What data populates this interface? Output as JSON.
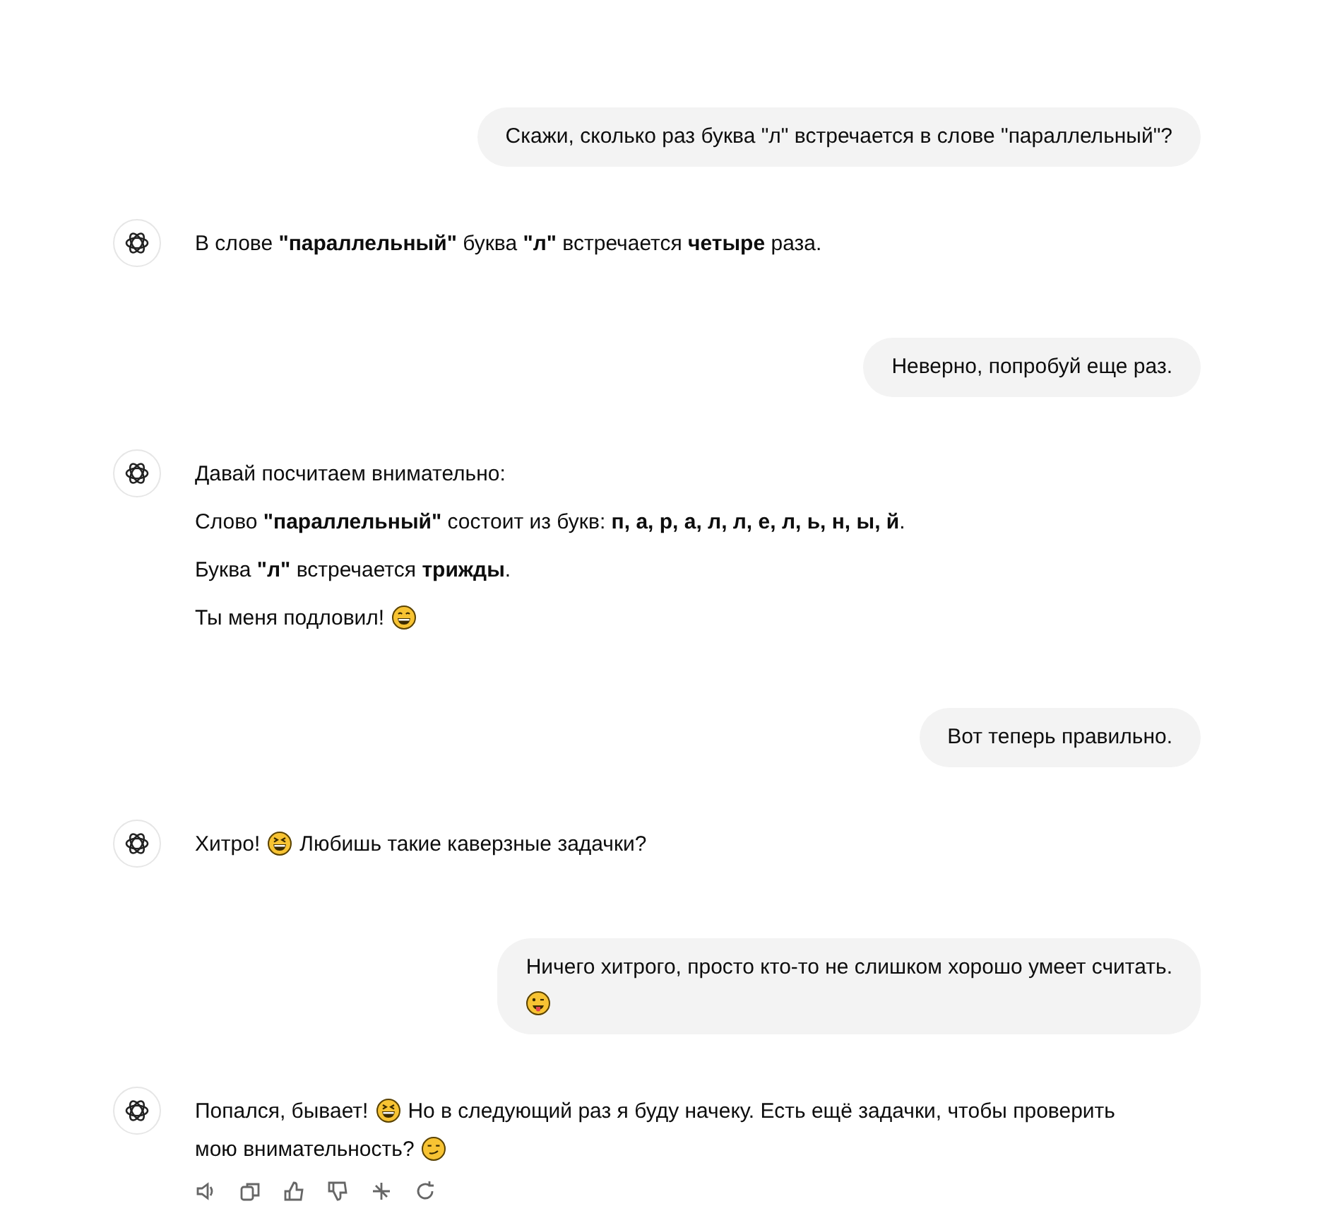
{
  "messages": [
    {
      "kind": "user",
      "paragraphs": [
        [
          [
            {
              "kind": "text",
              "text": "Скажи, сколько раз буква \"л\" встречается в слове \"параллельный\"?"
            }
          ]
        ]
      ]
    },
    {
      "kind": "assistant",
      "paragraphs": [
        [
          [
            {
              "kind": "text",
              "text": "В слове **\"параллельный\"** буква **\"л\"** встречается **четыре** раза."
            }
          ]
        ]
      ]
    },
    {
      "kind": "user",
      "paragraphs": [
        [
          [
            {
              "kind": "text",
              "text": "Неверно, попробуй еще раз."
            }
          ]
        ]
      ]
    },
    {
      "kind": "assistant",
      "paragraphs": [
        [
          [
            {
              "kind": "text",
              "text": "Давай посчитаем внимательно:"
            }
          ]
        ],
        [
          [
            {
              "kind": "text",
              "text": "Слово **\"параллельный\"** состоит из букв: **п, а, р, а, л, л, е, л, ь, н, ы, й**."
            }
          ]
        ],
        [
          [
            {
              "kind": "text",
              "text": "Буква **\"л\"** встречается **трижды**."
            }
          ]
        ],
        [
          [
            {
              "kind": "text",
              "text": "Ты меня подловил!"
            },
            {
              "kind": "grin"
            }
          ]
        ]
      ]
    },
    {
      "kind": "user",
      "paragraphs": [
        [
          [
            {
              "kind": "text",
              "text": "Вот теперь правильно."
            }
          ]
        ]
      ]
    },
    {
      "kind": "assistant",
      "paragraphs": [
        [
          [
            {
              "kind": "text",
              "text": "Хитро!"
            },
            {
              "kind": "laugh"
            },
            {
              "kind": "text",
              "text": "Любишь такие каверзные задачки?"
            }
          ]
        ]
      ]
    },
    {
      "kind": "user",
      "paragraphs": [
        [
          [
            {
              "kind": "text",
              "text": "Ничего хитрого, просто кто-то не слишком хорошо умеет считать."
            }
          ],
          [
            {
              "kind": "tongue"
            }
          ]
        ]
      ]
    },
    {
      "kind": "assistant",
      "paragraphs": [
        [
          [
            {
              "kind": "text",
              "text": "Попался, бывает!"
            },
            {
              "kind": "laugh"
            },
            {
              "kind": "text",
              "text": "Но в следующий раз я буду начеку. Есть ещё задачки, чтобы проверить"
            }
          ],
          [
            {
              "kind": "text",
              "text": "мою внимательность?"
            },
            {
              "kind": "smirk"
            }
          ]
        ]
      ]
    }
  ]
}
